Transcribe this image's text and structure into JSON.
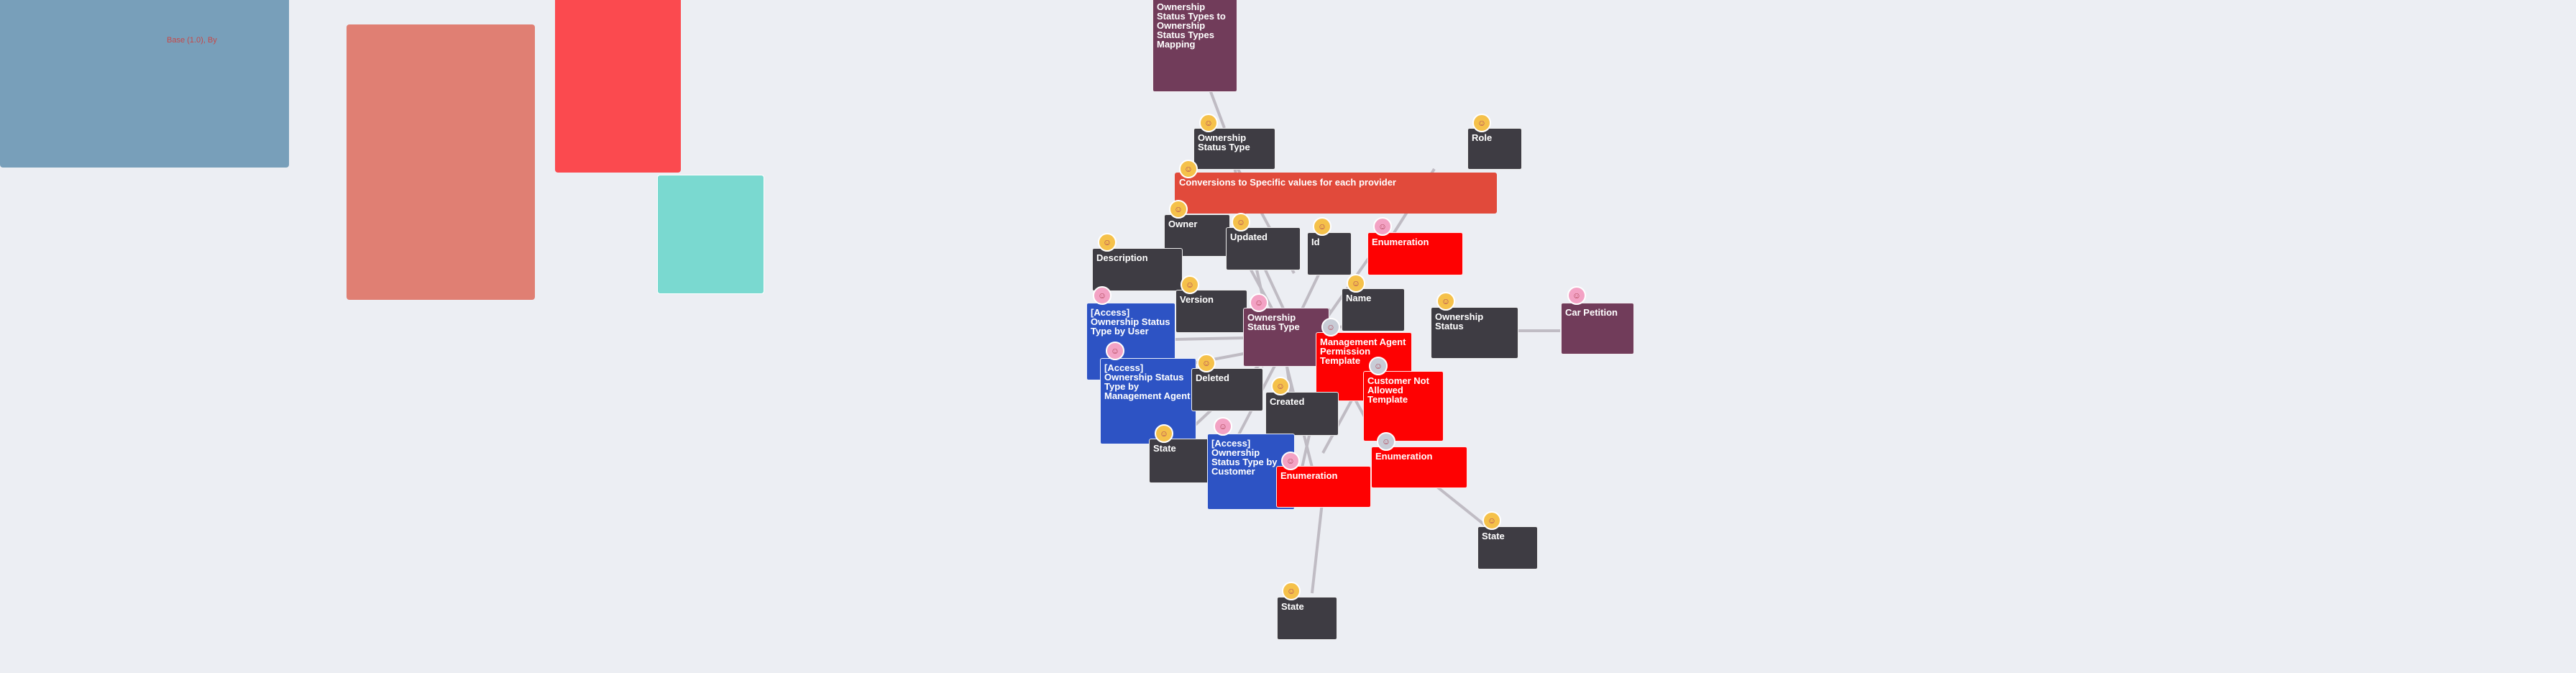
{
  "regions": {
    "blue_label": "Base (1.0), By"
  },
  "colors": {
    "background": "#eceef3",
    "edge": "#b8b3bb",
    "dark_node": "#3e3c43",
    "purple_node": "#713c5a",
    "blue_node": "#2d53c4",
    "red_node": "#fe0102",
    "orange_node": "#e14a3b"
  },
  "nodes": {
    "ownership_status_types_mapping": "Ownership Status Types to Ownership Status Types Mapping",
    "ownership_status_type_top": "Ownership Status Type",
    "role": "Role",
    "conversions_banner": "Conversions to Specific values for each provider",
    "owner": "Owner",
    "updated": "Updated",
    "id": "Id",
    "enumeration_top": "Enumeration",
    "description": "Description",
    "version": "Version",
    "name": "Name",
    "ownership_status_type_center": "Ownership Status Type",
    "ownership_status": "Ownership Status",
    "car_petition": "Car Petition",
    "access_by_user": "[Access] Ownership Status Type by User",
    "access_by_management_agent": "[Access] Ownership Status Type by Management Agent",
    "management_agent_permission_template": "Management Agent Permission Template",
    "customer_not_allowed_template": "Customer Not Allowed Template",
    "deleted": "Deleted",
    "created": "Created",
    "state_left": "State",
    "access_by_customer": "[Access] Ownership Status Type by Customer",
    "enumeration_bottom_center": "Enumeration",
    "enumeration_right": "Enumeration",
    "state_right": "State",
    "state_bottom": "State"
  }
}
